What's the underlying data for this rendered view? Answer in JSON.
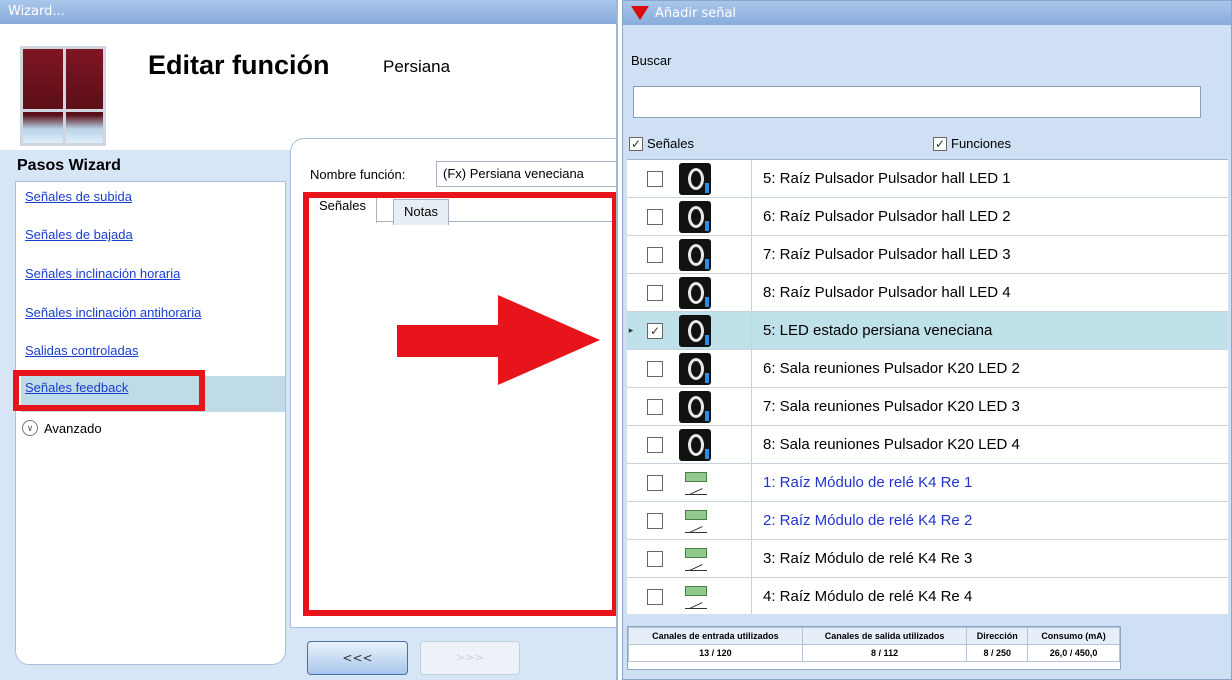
{
  "wizard": {
    "title": "Wizard...",
    "heading": "Editar función",
    "subheading": "Persiana",
    "steps_title": "Pasos Wizard",
    "steps": [
      {
        "label": "Señales de subida"
      },
      {
        "label": "Señales de bajada"
      },
      {
        "label": "Señales inclinación horaria"
      },
      {
        "label": "Señales inclinación antihoraria"
      },
      {
        "label": "Salidas controladas"
      },
      {
        "label": "Señales feedback"
      }
    ],
    "advanced_label": "Avanzado",
    "function_name_label": "Nombre función:",
    "function_name_value": "(Fx) Persiana veneciana",
    "tabs": [
      {
        "label": "Señales"
      },
      {
        "label": "Notas"
      }
    ],
    "prev_label": "<<<",
    "next_label": ">>>"
  },
  "signals_window": {
    "title": "Añadir señal",
    "search_label": "Buscar",
    "search_value": "",
    "filter_signals_label": "Señales",
    "filter_functions_label": "Funciones",
    "rows": [
      {
        "label": "5: Raíz Pulsador Pulsador hall LED 1",
        "icon": "pushbutton-icon",
        "checked": false
      },
      {
        "label": "6: Raíz Pulsador Pulsador hall LED 2",
        "icon": "pushbutton-icon",
        "checked": false
      },
      {
        "label": "7: Raíz Pulsador Pulsador hall LED 3",
        "icon": "pushbutton-icon",
        "checked": false
      },
      {
        "label": "8: Raíz Pulsador Pulsador hall LED 4",
        "icon": "pushbutton-icon",
        "checked": false
      },
      {
        "label": "5: LED estado persiana veneciana",
        "icon": "pushbutton-icon",
        "checked": true
      },
      {
        "label": "6: Sala reuniones Pulsador K20 LED 2",
        "icon": "pushbutton-icon",
        "checked": false
      },
      {
        "label": "7: Sala reuniones Pulsador K20 LED 3",
        "icon": "pushbutton-icon",
        "checked": false
      },
      {
        "label": "8: Sala reuniones Pulsador K20 LED 4",
        "icon": "pushbutton-icon",
        "checked": false
      },
      {
        "label": "1: Raíz Módulo de relé K4 Re 1",
        "icon": "relay-icon",
        "checked": false
      },
      {
        "label": "2: Raíz Módulo de relé K4 Re 2",
        "icon": "relay-icon",
        "checked": false
      },
      {
        "label": "3: Raíz Módulo de relé K4 Re 3",
        "icon": "relay-icon",
        "checked": false
      },
      {
        "label": "4: Raíz Módulo de relé K4 Re 4",
        "icon": "relay-icon",
        "checked": false
      }
    ],
    "stats": {
      "headers": [
        "Canales de entrada utilizados",
        "Canales de salida utilizados",
        "Dirección",
        "Consumo (mA)"
      ],
      "values": [
        "13 / 120",
        "8 / 112",
        "8 / 250",
        "26,0 / 450,0"
      ]
    }
  },
  "colors": {
    "highlight_red": "#e8141c",
    "link_blue": "#1a3ecf",
    "selected_row": "#bfe1ea"
  }
}
